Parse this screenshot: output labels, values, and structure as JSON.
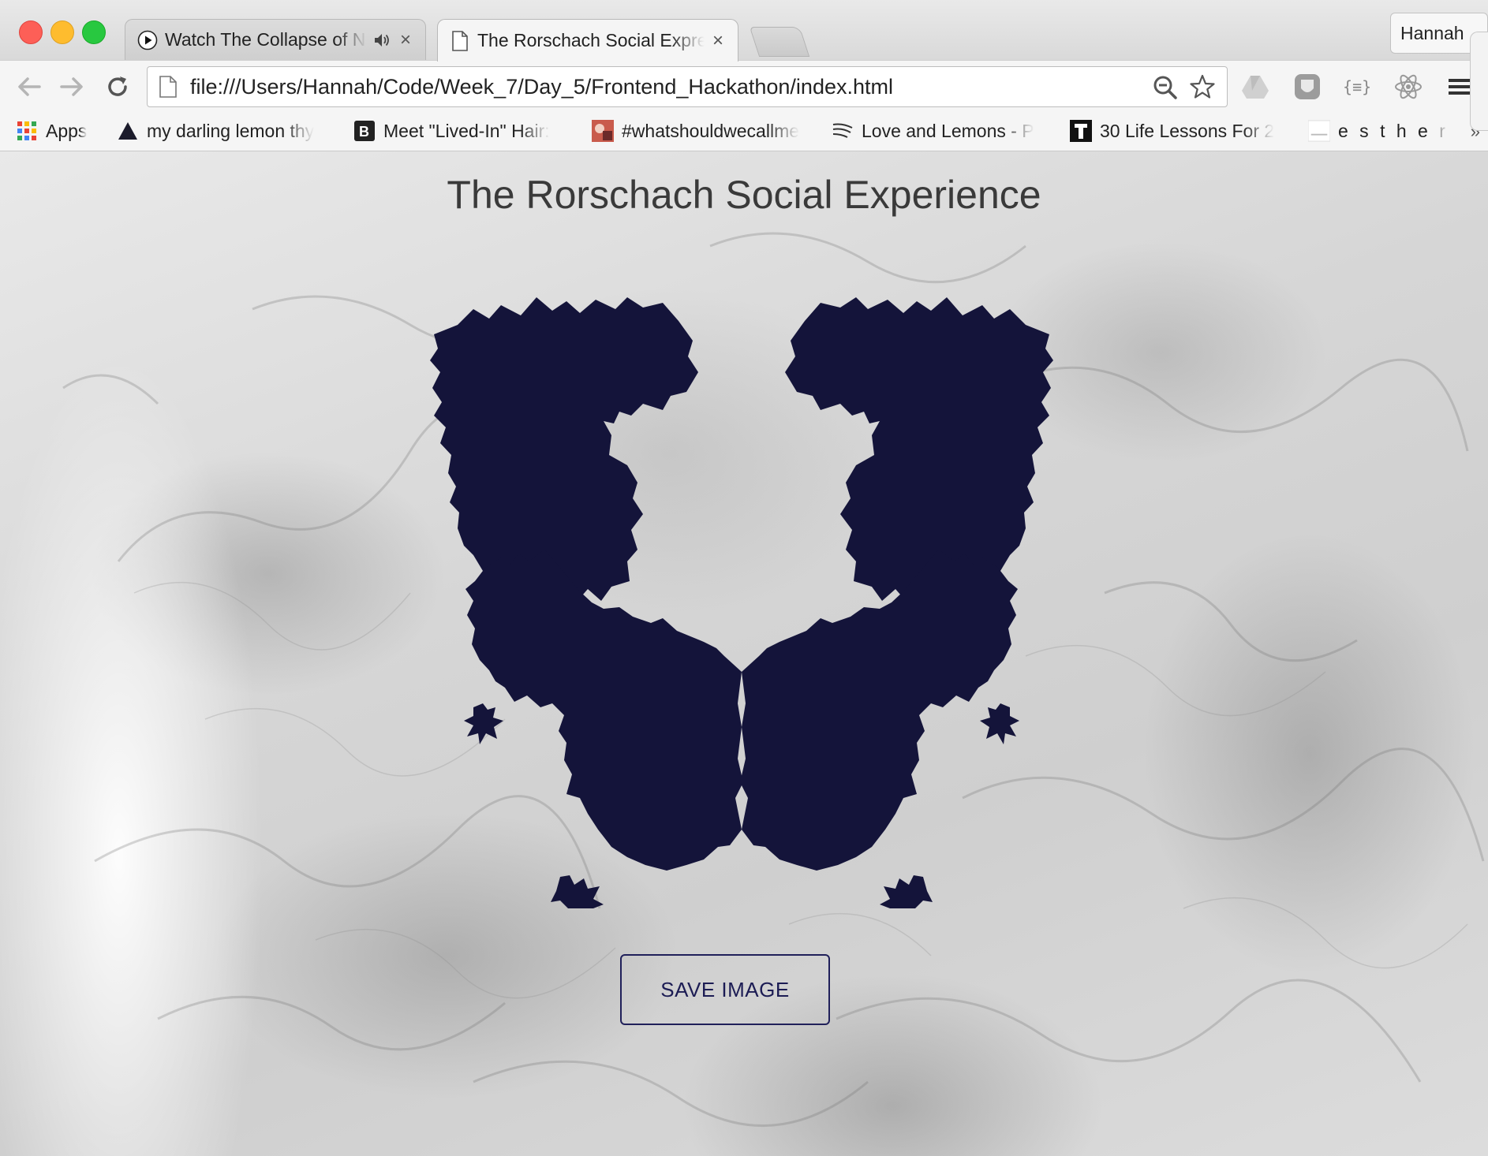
{
  "tabs": [
    {
      "title": "Watch The Collapse of N",
      "playing_audio": true
    },
    {
      "title": "The Rorschach Social Expre",
      "active": true
    }
  ],
  "profile_name": "Hannah",
  "address_bar": {
    "url": "file:///Users/Hannah/Code/Week_7/Day_5/Frontend_Hackathon/index.html"
  },
  "bookmarks": [
    {
      "label": "Apps",
      "icon": "apps-grid-icon"
    },
    {
      "label": "my darling lemon thy",
      "icon": "triangle-icon"
    },
    {
      "label": "Meet \"Lived-In\" Hair:",
      "icon": "b-icon"
    },
    {
      "label": "#whatshouldwecallme",
      "icon": "image-favicon"
    },
    {
      "label": "Love and Lemons - P",
      "icon": "whisk-icon"
    },
    {
      "label": "30 Life Lessons For 2",
      "icon": "t-icon"
    },
    {
      "label": "e s t h e r",
      "icon": "esther-favicon"
    }
  ],
  "page": {
    "title": "The Rorschach Social Experience",
    "save_button_label": "SAVE IMAGE",
    "inkblot_color": "#14143a"
  },
  "colors": {
    "close": "#fd5f57",
    "minimize": "#febc2e",
    "maximize": "#28c840",
    "button_border": "#20205a"
  }
}
